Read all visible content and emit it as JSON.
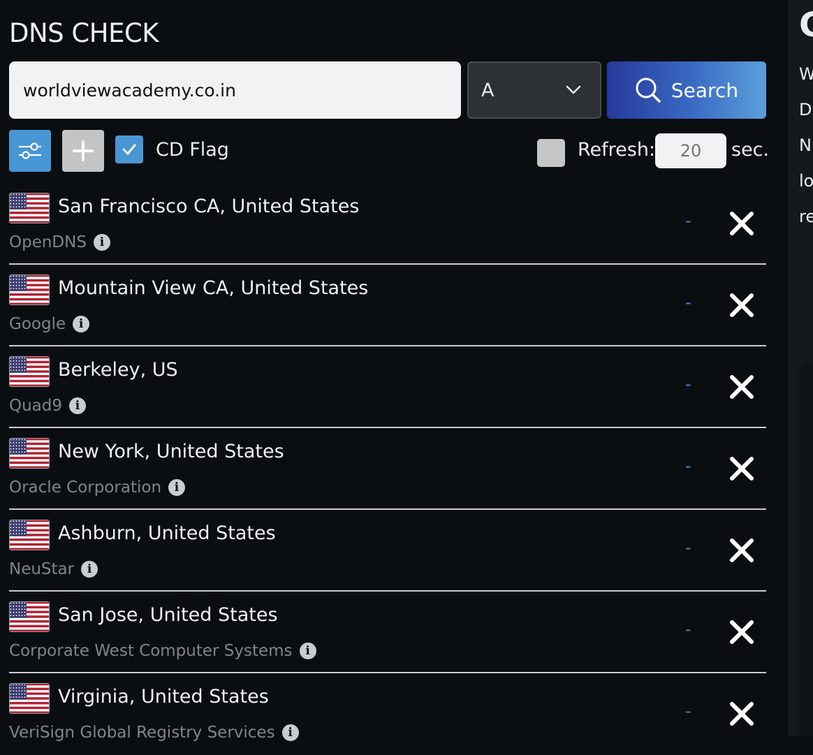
{
  "app": {
    "title": "DNS CHECK"
  },
  "search": {
    "domain_value": "worldviewacademy.co.in",
    "record_type": "A",
    "button_label": "Search"
  },
  "options": {
    "cd_flag_label": "CD Flag",
    "cd_flag_checked": true,
    "refresh_label": "Refresh:",
    "refresh_checked": false,
    "refresh_placeholder": "20",
    "refresh_unit": "sec."
  },
  "servers": [
    {
      "location": "San Francisco CA, United States",
      "provider": "OpenDNS",
      "result": "-"
    },
    {
      "location": "Mountain View CA, United States",
      "provider": "Google",
      "result": "-"
    },
    {
      "location": "Berkeley, US",
      "provider": "Quad9",
      "result": "-"
    },
    {
      "location": "New York, United States",
      "provider": "Oracle Corporation",
      "result": "-"
    },
    {
      "location": "Ashburn, United States",
      "provider": "NeuStar",
      "result": "-"
    },
    {
      "location": "San Jose, United States",
      "provider": "Corporate West Computer Systems",
      "result": "-"
    },
    {
      "location": "Virginia, United States",
      "provider": "VeriSign Global Registry Services",
      "result": "-"
    }
  ],
  "side_panel": {
    "title_fragment": "C",
    "line_fragments": [
      "W",
      "D",
      "N",
      "lo",
      "re"
    ]
  },
  "colors": {
    "background": "#0b0e11",
    "accent_blue": "#4996d4",
    "search_gradient_start": "#26399a",
    "search_gradient_end": "#5b9fd8"
  }
}
